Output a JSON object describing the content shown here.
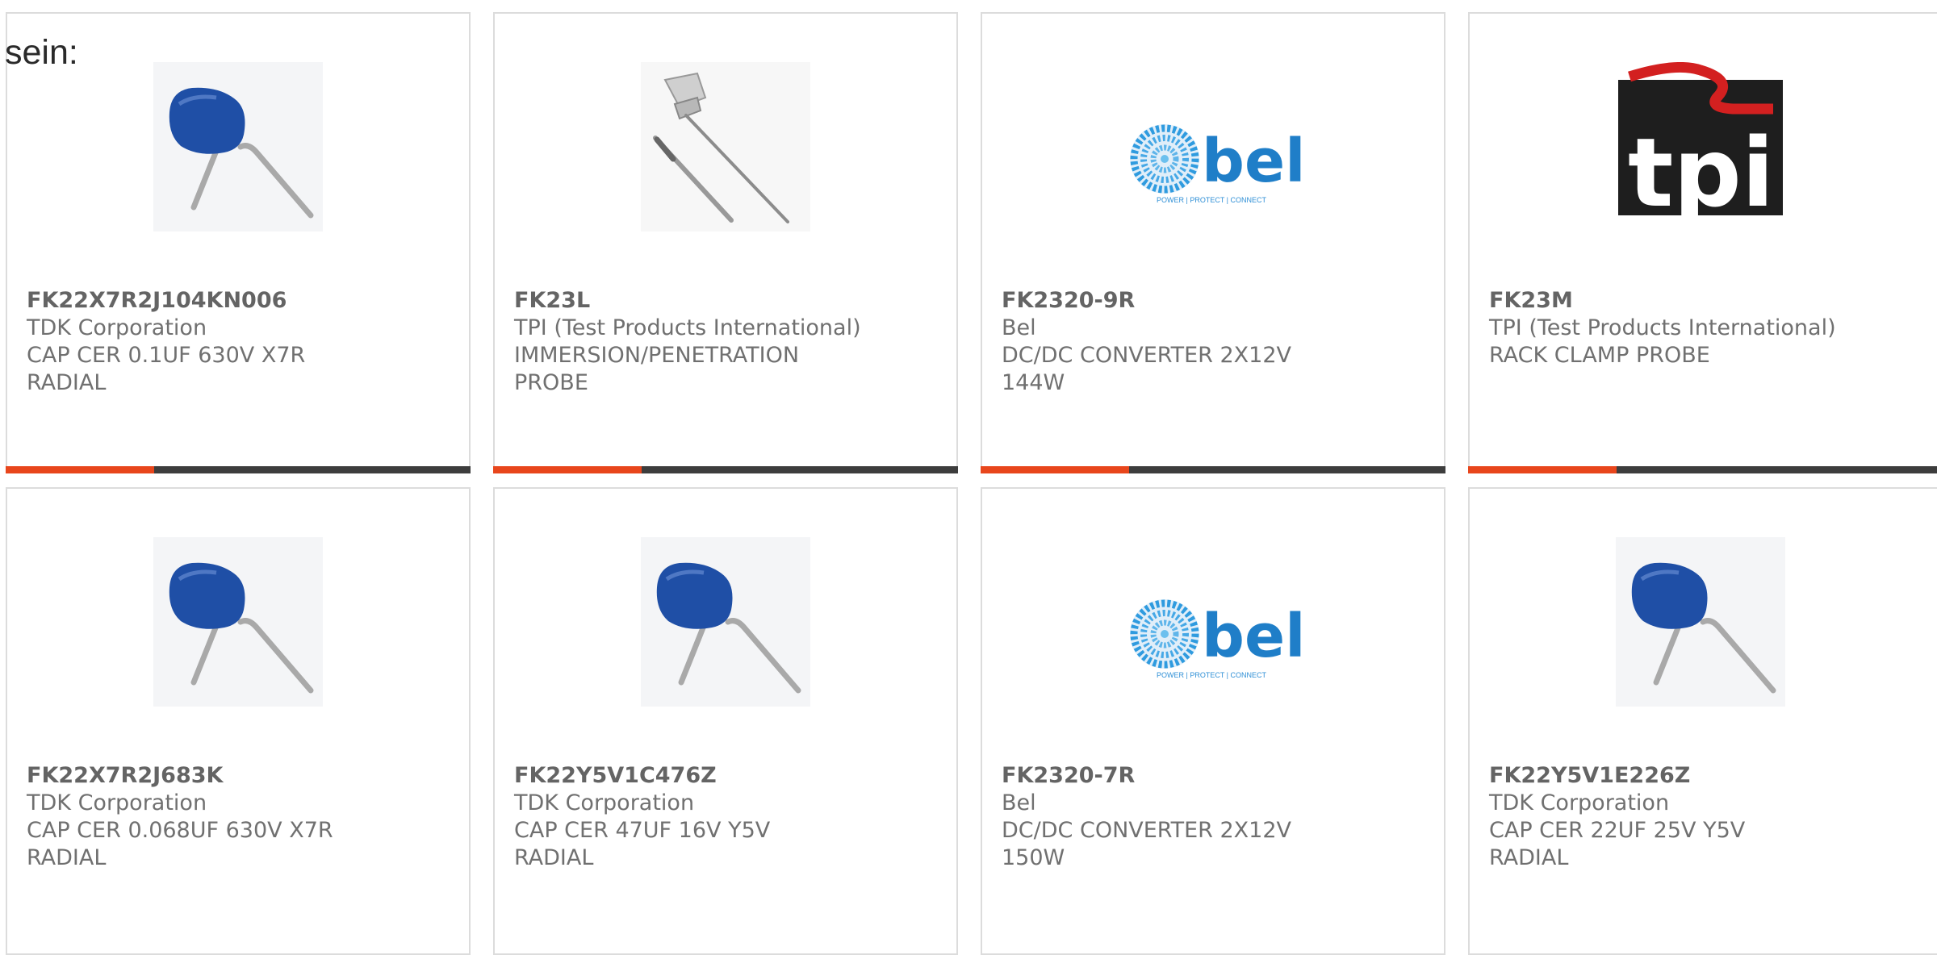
{
  "lead_text": "sein:",
  "accent_color": "#e8461c",
  "bar_color": "#3d3d3d",
  "products": [
    {
      "part_number": "FK22X7R2J104KN006",
      "manufacturer": "TDK Corporation",
      "description": "CAP CER 0.1UF 630V X7R RADIAL",
      "image": "blue-radial-capacitor"
    },
    {
      "part_number": "FK23L",
      "manufacturer": "TPI (Test Products International)",
      "description": "IMMERSION/PENETRATION PROBE",
      "image": "immersion-probe"
    },
    {
      "part_number": "FK2320-9R",
      "manufacturer": "Bel",
      "description": "DC/DC CONVERTER 2X12V 144W",
      "image": "bel-logo",
      "logo_text": "bel",
      "logo_tagline": "POWER | PROTECT | CONNECT"
    },
    {
      "part_number": "FK23M",
      "manufacturer": "TPI (Test Products International)",
      "description": "RACK CLAMP PROBE",
      "image": "tpi-logo",
      "logo_text": "tpi"
    },
    {
      "part_number": "FK22X7R2J683K",
      "manufacturer": "TDK Corporation",
      "description": "CAP CER 0.068UF 630V X7R RADIAL",
      "image": "blue-radial-capacitor"
    },
    {
      "part_number": "FK22Y5V1C476Z",
      "manufacturer": "TDK Corporation",
      "description": "CAP CER 47UF 16V Y5V RADIAL",
      "image": "blue-radial-capacitor"
    },
    {
      "part_number": "FK2320-7R",
      "manufacturer": "Bel",
      "description": "DC/DC CONVERTER 2X12V 150W",
      "image": "bel-logo",
      "logo_text": "bel",
      "logo_tagline": "POWER | PROTECT | CONNECT"
    },
    {
      "part_number": "FK22Y5V1E226Z",
      "manufacturer": "TDK Corporation",
      "description": "CAP CER 22UF 25V Y5V RADIAL",
      "image": "blue-radial-capacitor"
    }
  ]
}
